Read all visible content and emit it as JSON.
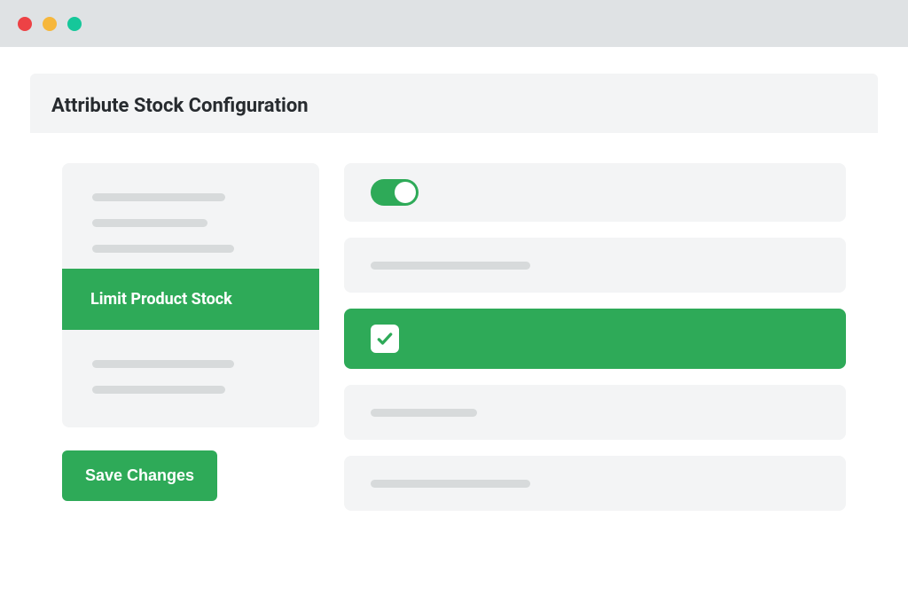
{
  "header": {
    "title": "Attribute Stock Configuration"
  },
  "sidebar": {
    "active_label": "Limit Product Stock"
  },
  "actions": {
    "save_label": "Save Changes"
  },
  "settings": {
    "toggle_on": true,
    "highlight_checked": true
  }
}
